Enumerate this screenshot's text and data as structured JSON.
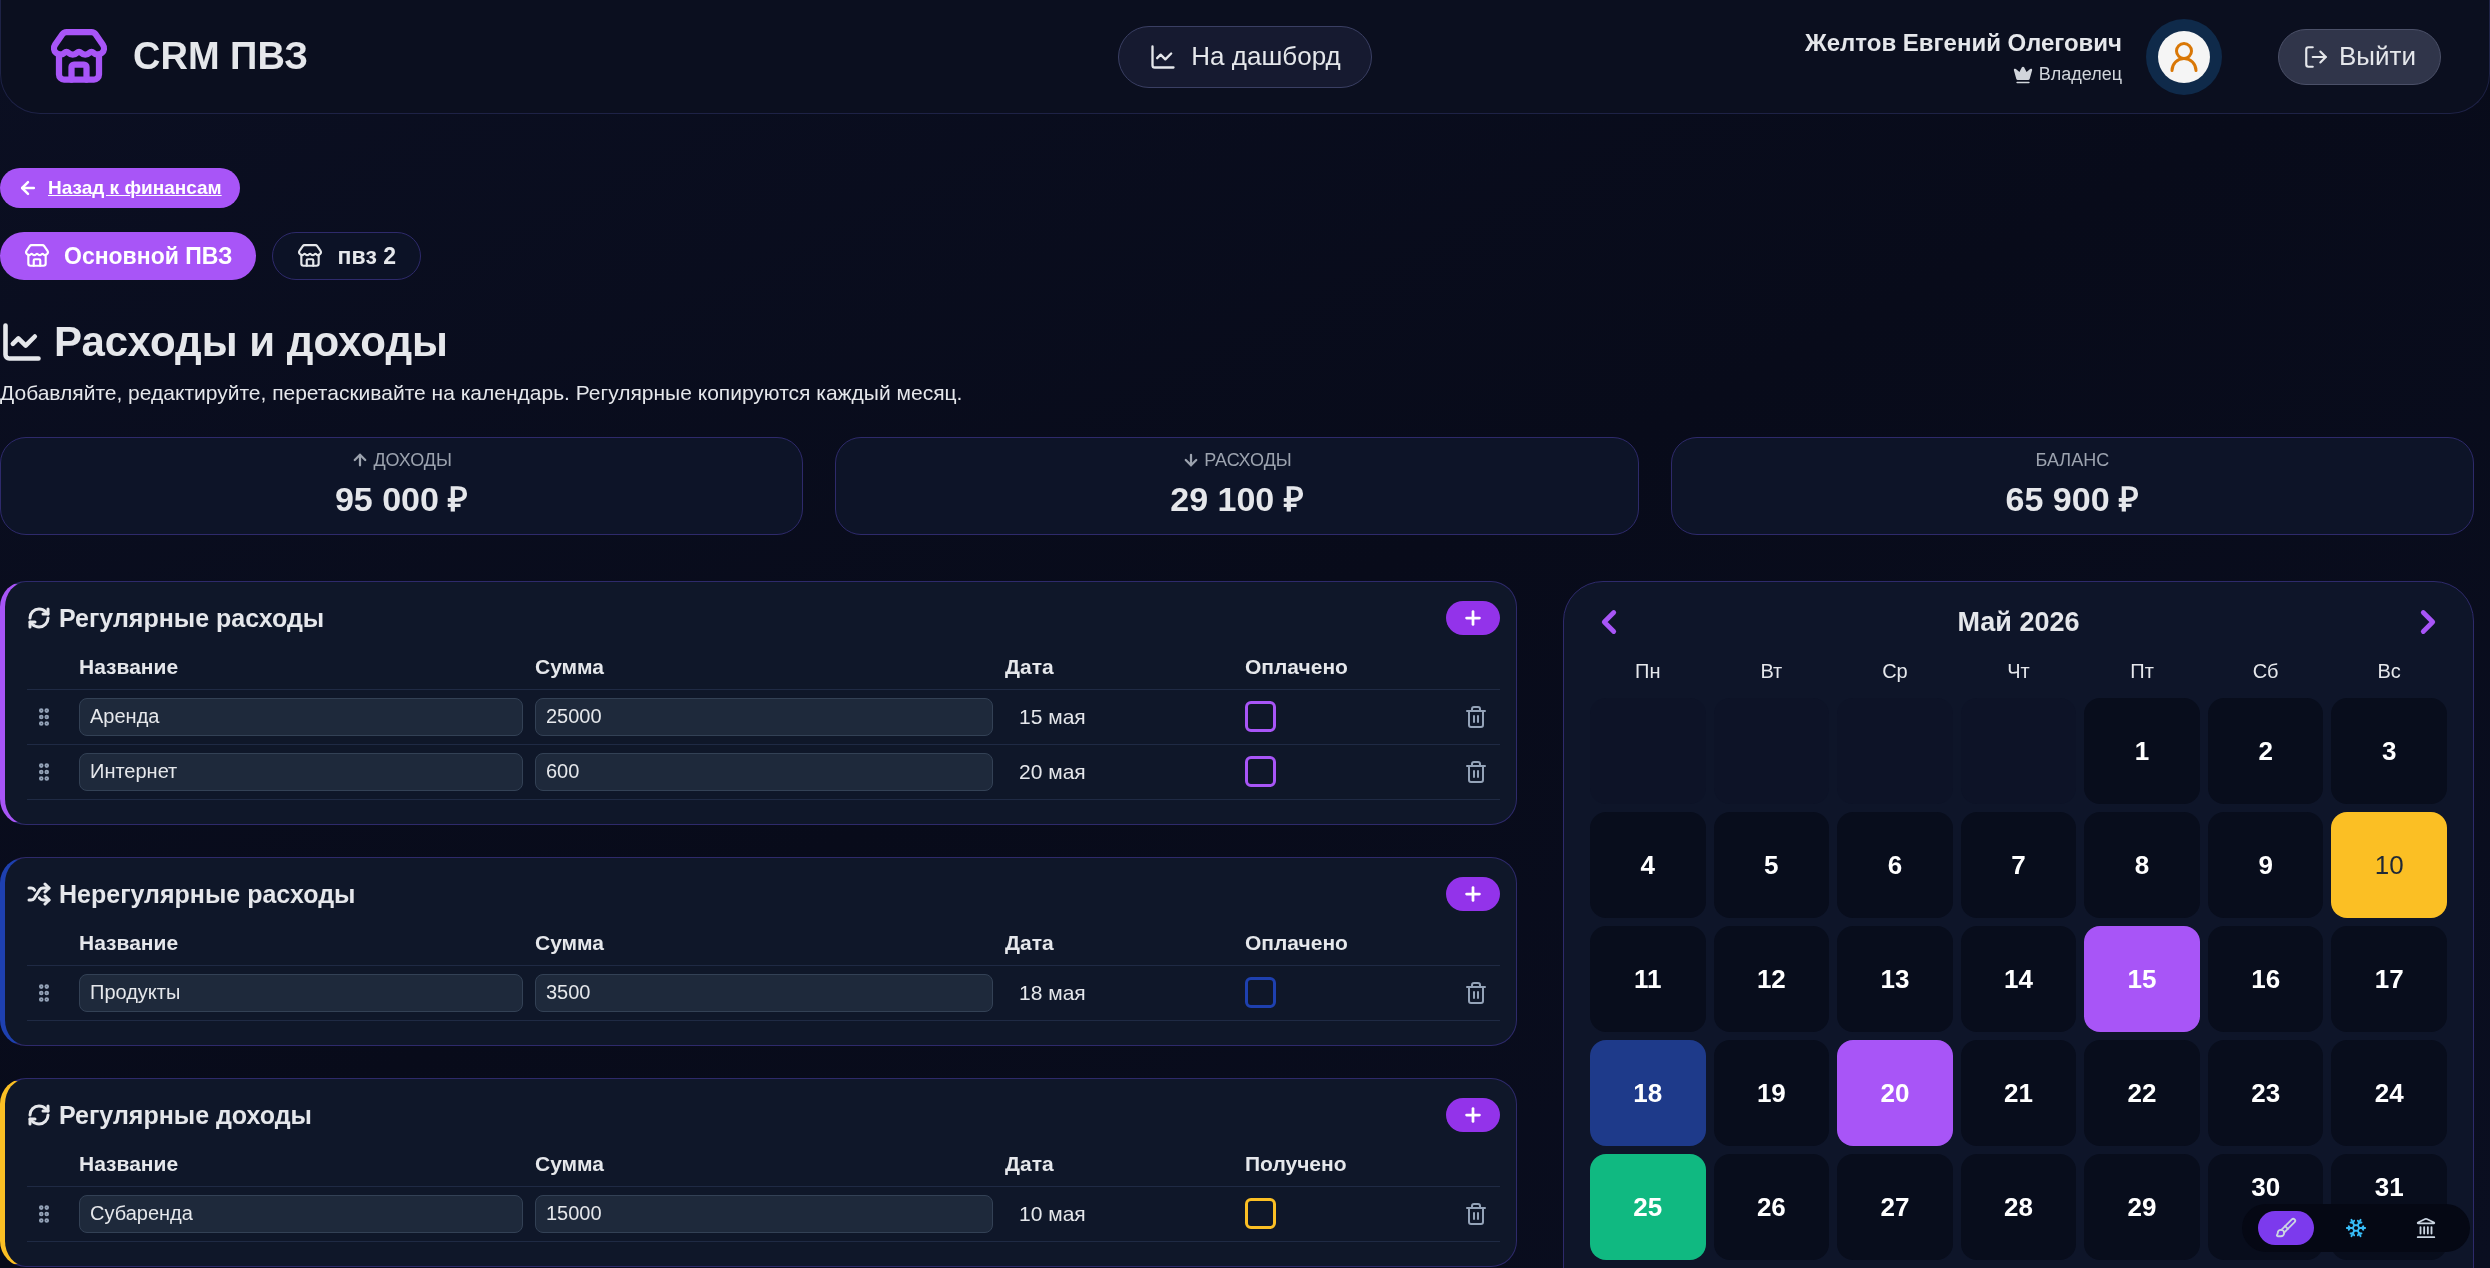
{
  "header": {
    "app_name": "CRM ПВЗ",
    "dashboard_button": "На дашборд",
    "user_name": "Желтов Евгений Олегович",
    "user_role": "Владелец",
    "logout_button": "Выйти"
  },
  "back_link": "Назад к финансам",
  "points": [
    {
      "label": "Основной ПВЗ",
      "selected": true
    },
    {
      "label": "пвз 2",
      "selected": false
    }
  ],
  "title": "Расходы и доходы",
  "subtitle": "Добавляйте, редактируйте, перетаскивайте на календарь. Регулярные копируются каждый месяц.",
  "stats": [
    {
      "kind": "income",
      "label": "ДОХОДЫ",
      "value": "95 000 ₽"
    },
    {
      "kind": "expense",
      "label": "РАСХОДЫ",
      "value": "29 100 ₽"
    },
    {
      "kind": "balance",
      "label": "БАЛАНС",
      "value": "65 900 ₽"
    }
  ],
  "sections": [
    {
      "kind": "regular",
      "title": "Регулярные расходы",
      "color": "#a855f7",
      "columns": [
        "Название",
        "Сумма",
        "Дата",
        "Оплачено"
      ],
      "rows": [
        {
          "name": "Аренда",
          "amount": "25000",
          "date": "15 мая",
          "checked": false
        },
        {
          "name": "Интернет",
          "amount": "600",
          "date": "20 мая",
          "checked": false
        }
      ]
    },
    {
      "kind": "irregular",
      "title": "Нерегулярные расходы",
      "color": "#1e40af",
      "columns": [
        "Название",
        "Сумма",
        "Дата",
        "Оплачено"
      ],
      "rows": [
        {
          "name": "Продукты",
          "amount": "3500",
          "date": "18 мая",
          "checked": false
        }
      ]
    },
    {
      "kind": "regular",
      "title": "Регулярные доходы",
      "color": "#fbbf24",
      "columns": [
        "Название",
        "Сумма",
        "Дата",
        "Получено"
      ],
      "rows": [
        {
          "name": "Субаренда",
          "amount": "15000",
          "date": "10 мая",
          "checked": false
        }
      ]
    }
  ],
  "calendar": {
    "month": "Май 2026",
    "weekdays": [
      "Пн",
      "Вт",
      "Ср",
      "Чт",
      "Пт",
      "Сб",
      "Вс"
    ],
    "cells": [
      {
        "kind": "blank"
      },
      {
        "kind": "blank"
      },
      {
        "kind": "blank"
      },
      {
        "kind": "blank"
      },
      {
        "kind": "day",
        "day": "1"
      },
      {
        "kind": "day",
        "day": "2"
      },
      {
        "kind": "day",
        "day": "3"
      },
      {
        "kind": "day",
        "day": "4"
      },
      {
        "kind": "day",
        "day": "5"
      },
      {
        "kind": "day",
        "day": "6"
      },
      {
        "kind": "day",
        "day": "7"
      },
      {
        "kind": "day",
        "day": "8"
      },
      {
        "kind": "day",
        "day": "9"
      },
      {
        "kind": "day",
        "day": "10",
        "color": "#fbbf24"
      },
      {
        "kind": "day",
        "day": "11"
      },
      {
        "kind": "day",
        "day": "12"
      },
      {
        "kind": "day",
        "day": "13"
      },
      {
        "kind": "day",
        "day": "14"
      },
      {
        "kind": "day",
        "day": "15",
        "color": "#a855f7"
      },
      {
        "kind": "day",
        "day": "16"
      },
      {
        "kind": "day",
        "day": "17"
      },
      {
        "kind": "day",
        "day": "18",
        "color": "#1e3a8a"
      },
      {
        "kind": "day",
        "day": "19"
      },
      {
        "kind": "day",
        "day": "20",
        "color": "#a855f7"
      },
      {
        "kind": "day",
        "day": "21"
      },
      {
        "kind": "day",
        "day": "22"
      },
      {
        "kind": "day",
        "day": "23"
      },
      {
        "kind": "day",
        "day": "24"
      },
      {
        "kind": "day",
        "day": "25",
        "color": "#10b981"
      },
      {
        "kind": "day",
        "day": "26"
      },
      {
        "kind": "day",
        "day": "27"
      },
      {
        "kind": "day",
        "day": "28"
      },
      {
        "kind": "day",
        "day": "29"
      },
      {
        "kind": "day",
        "day": "30"
      },
      {
        "kind": "day",
        "day": "31"
      }
    ]
  },
  "theme_switcher": [
    {
      "kind": "brush",
      "selected": true
    },
    {
      "kind": "snow",
      "selected": false
    },
    {
      "kind": "bank",
      "selected": false
    }
  ]
}
